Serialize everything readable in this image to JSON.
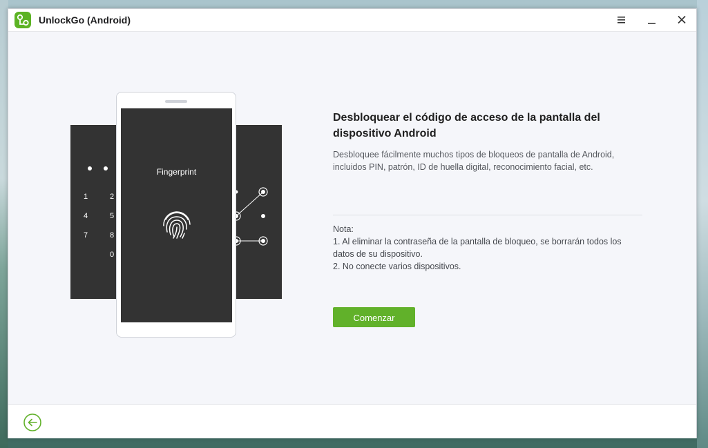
{
  "window": {
    "title": "UnlockGo (Android)",
    "logo_icon": "unlockgo-logo-icon",
    "controls": [
      "menu-icon",
      "minimize-icon",
      "close-icon"
    ]
  },
  "hero": {
    "fingerprint_label": "Fingerprint",
    "pin_digits": [
      "1",
      "2",
      "4",
      "5",
      "7",
      "8",
      "0"
    ]
  },
  "main": {
    "heading": "Desbloquear el código de acceso de la pantalla del dispositivo Android",
    "description": "Desbloquee fácilmente muchos tipos de bloqueos de pantalla de Android, incluidos PIN, patrón, ID de huella digital, reconocimiento facial, etc.",
    "note_title": "Nota:",
    "note_1": "1. Al eliminar la contraseña de la pantalla de bloqueo, se borrarán todos los datos de su dispositivo.",
    "note_2": "2. No conecte varios dispositivos.",
    "start_button": "Comenzar"
  },
  "footer": {
    "back_icon": "arrow-left-circle-icon"
  },
  "colors": {
    "accent": "#61b12a",
    "dark_panel": "#333333",
    "background": "#f5f6fa"
  }
}
